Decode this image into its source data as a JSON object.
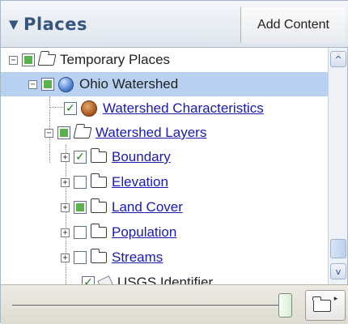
{
  "header": {
    "collapse_glyph": "▼",
    "title": "Places",
    "add_content_label": "Add Content"
  },
  "tree": [
    {
      "label": "Temporary Places",
      "icon": "folder-open-icon",
      "checkbox": "partial",
      "expander": "⊟",
      "link": false
    },
    {
      "label": "Ohio Watershed",
      "icon": "globe-icon",
      "checkbox": "partial",
      "expander": "⊟",
      "link": false,
      "selected": true
    },
    {
      "label": "Watershed Characteristics",
      "icon": "layer-icon",
      "checkbox": "checked",
      "expander": "",
      "link": true
    },
    {
      "label": "Watershed Layers",
      "icon": "folder-open-icon",
      "checkbox": "partial",
      "expander": "⊟",
      "link": true
    },
    {
      "label": "Boundary",
      "icon": "folder-icon",
      "checkbox": "checked",
      "expander": "⊞",
      "link": true
    },
    {
      "label": "Elevation",
      "icon": "folder-icon",
      "checkbox": "unchecked",
      "expander": "⊞",
      "link": true
    },
    {
      "label": "Land Cover",
      "icon": "folder-icon",
      "checkbox": "partial",
      "expander": "⊞",
      "link": true
    },
    {
      "label": "Population",
      "icon": "folder-icon",
      "checkbox": "unchecked",
      "expander": "⊞",
      "link": true
    },
    {
      "label": "Streams",
      "icon": "folder-icon",
      "checkbox": "unchecked",
      "expander": "⊞",
      "link": true
    },
    {
      "label": "USGS Identifier",
      "icon": "placemark-icon",
      "checkbox": "checked",
      "expander": "",
      "link": false
    }
  ],
  "scrollbar": {
    "up_glyph": "^",
    "down_glyph": "v"
  },
  "footer": {
    "folder_menu_arrow": "▸"
  },
  "colors": {
    "title": "#35557f",
    "link": "#1a1ab3",
    "selection": "#b8d1f1",
    "partial_check": "#58b34a"
  }
}
